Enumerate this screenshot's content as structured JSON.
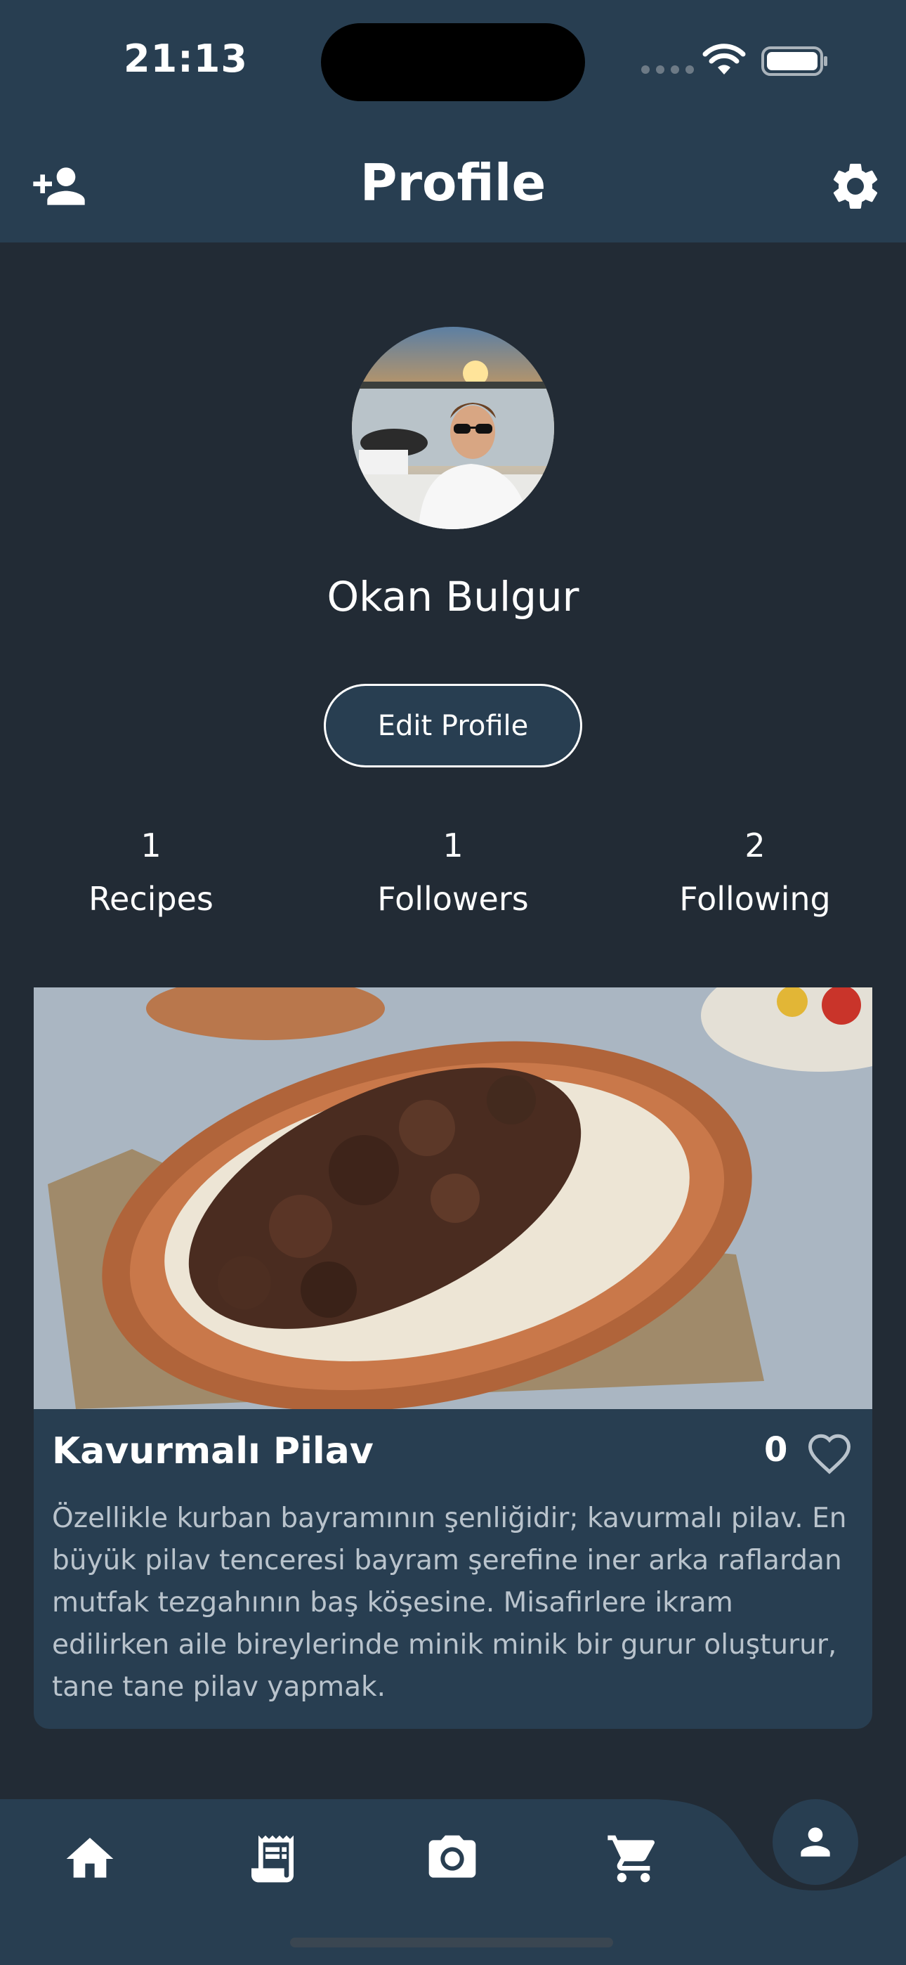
{
  "status": {
    "time": "21:13"
  },
  "header": {
    "title": "Profile"
  },
  "profile": {
    "name": "Okan Bulgur",
    "edit_label": "Edit Profile",
    "stats": [
      {
        "value": "1",
        "label": "Recipes"
      },
      {
        "value": "1",
        "label": "Followers"
      },
      {
        "value": "2",
        "label": "Following"
      }
    ]
  },
  "recipe": {
    "title": "Kavurmalı Pilav",
    "likes": "0",
    "description": "Özellikle kurban bayramının şenliğidir; kavurmalı pilav. En büyük pilav tenceresi bayram şerefine iner arka raflardan mutfak tezgahının baş köşesine. Misafirlere ikram edilirken aile bireylerinde minik minik bir gurur oluşturur, tane tane pilav yapmak."
  },
  "nav": {
    "items": [
      "home-icon",
      "recipe-icon",
      "camera-icon",
      "cart-icon",
      "person-icon"
    ]
  },
  "colors": {
    "background": "#222b35",
    "header": "#283e51",
    "card": "#283e51",
    "text": "#ffffff",
    "muted_text": "#b9c3cc"
  }
}
